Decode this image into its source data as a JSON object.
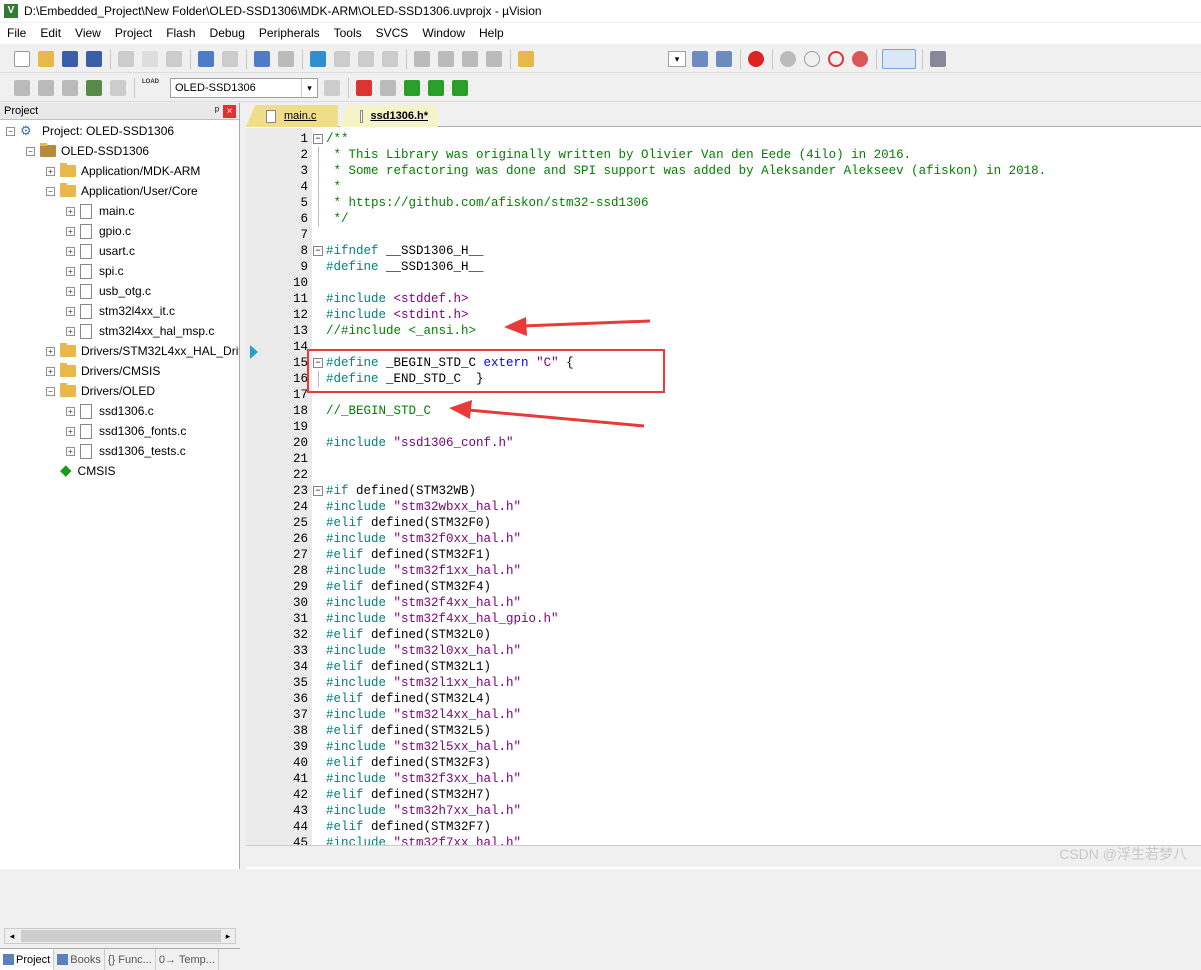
{
  "window": {
    "title": "D:\\Embedded_Project\\New Folder\\OLED-SSD1306\\MDK-ARM\\OLED-SSD1306.uvprojx - µVision",
    "app_icon": "V"
  },
  "menu": [
    "File",
    "Edit",
    "View",
    "Project",
    "Flash",
    "Debug",
    "Peripherals",
    "Tools",
    "SVCS",
    "Window",
    "Help"
  ],
  "toolbar2": {
    "target": "OLED-SSD1306",
    "load_label": "LOAD"
  },
  "project_panel": {
    "title": "Project",
    "pin": "ᵖ",
    "close": "×",
    "tree": [
      {
        "label": "Project: OLED-SSD1306",
        "kind": "project",
        "exp": "−"
      },
      {
        "label": "OLED-SSD1306",
        "kind": "target",
        "exp": "−"
      },
      {
        "label": "Application/MDK-ARM",
        "kind": "folder",
        "exp": "+"
      },
      {
        "label": "Application/User/Core",
        "kind": "folder",
        "exp": "−"
      },
      {
        "label": "main.c",
        "kind": "file",
        "exp": "+"
      },
      {
        "label": "gpio.c",
        "kind": "file",
        "exp": "+"
      },
      {
        "label": "usart.c",
        "kind": "file",
        "exp": "+"
      },
      {
        "label": "spi.c",
        "kind": "file",
        "exp": "+"
      },
      {
        "label": "usb_otg.c",
        "kind": "file",
        "exp": "+"
      },
      {
        "label": "stm32l4xx_it.c",
        "kind": "file",
        "exp": "+"
      },
      {
        "label": "stm32l4xx_hal_msp.c",
        "kind": "file",
        "exp": "+"
      },
      {
        "label": "Drivers/STM32L4xx_HAL_Driv",
        "kind": "folder",
        "exp": "+"
      },
      {
        "label": "Drivers/CMSIS",
        "kind": "folder",
        "exp": "+"
      },
      {
        "label": "Drivers/OLED",
        "kind": "folder",
        "exp": "−"
      },
      {
        "label": "ssd1306.c",
        "kind": "file",
        "exp": "+"
      },
      {
        "label": "ssd1306_fonts.c",
        "kind": "file",
        "exp": "+"
      },
      {
        "label": "ssd1306_tests.c",
        "kind": "file",
        "exp": "+"
      },
      {
        "label": "CMSIS",
        "kind": "cmsis",
        "exp": ""
      }
    ],
    "tabs": [
      "Project",
      "Books",
      "{} Func...",
      "0→ Temp..."
    ]
  },
  "editor": {
    "tabs": [
      {
        "label": "main.c",
        "active": false
      },
      {
        "label": "ssd1306.h*",
        "active": true
      }
    ],
    "lines": [
      {
        "n": "1",
        "fold": "−",
        "segs": [
          {
            "c": "cm",
            "t": "/**"
          }
        ]
      },
      {
        "n": "2",
        "fold": "|",
        "segs": [
          {
            "c": "cm",
            "t": " * This Library was originally written by Olivier Van den Eede (4ilo) in 2016."
          }
        ]
      },
      {
        "n": "3",
        "fold": "|",
        "segs": [
          {
            "c": "cm",
            "t": " * Some refactoring was done and SPI support was added by Aleksander Alekseev (afiskon) in 2018."
          }
        ]
      },
      {
        "n": "4",
        "fold": "|",
        "segs": [
          {
            "c": "cm",
            "t": " *"
          }
        ]
      },
      {
        "n": "5",
        "fold": "|",
        "segs": [
          {
            "c": "cm",
            "t": " * https://github.com/afiskon/stm32-ssd1306"
          }
        ]
      },
      {
        "n": "6",
        "fold": "|",
        "segs": [
          {
            "c": "cm",
            "t": " */"
          }
        ]
      },
      {
        "n": "7",
        "fold": "",
        "segs": []
      },
      {
        "n": "8",
        "fold": "−",
        "segs": [
          {
            "c": "pp",
            "t": "#ifndef"
          },
          {
            "c": "plain",
            "t": " __SSD1306_H__"
          }
        ]
      },
      {
        "n": "9",
        "fold": "",
        "segs": [
          {
            "c": "pp",
            "t": "#define"
          },
          {
            "c": "plain",
            "t": " __SSD1306_H__"
          }
        ]
      },
      {
        "n": "10",
        "fold": "",
        "segs": []
      },
      {
        "n": "11",
        "fold": "",
        "segs": [
          {
            "c": "pp",
            "t": "#include"
          },
          {
            "c": "str",
            "t": " <stddef.h>"
          }
        ]
      },
      {
        "n": "12",
        "fold": "",
        "segs": [
          {
            "c": "pp",
            "t": "#include"
          },
          {
            "c": "str",
            "t": " <stdint.h>"
          }
        ]
      },
      {
        "n": "13",
        "fold": "",
        "segs": [
          {
            "c": "cm",
            "t": "//#include <_ansi.h>"
          }
        ]
      },
      {
        "n": "14",
        "fold": "",
        "segs": []
      },
      {
        "n": "15",
        "fold": "−",
        "segs": [
          {
            "c": "pp",
            "t": "#define"
          },
          {
            "c": "plain",
            "t": " _BEGIN_STD_C "
          },
          {
            "c": "kw",
            "t": "extern"
          },
          {
            "c": "str",
            "t": " \"C\""
          },
          {
            "c": "plain",
            "t": " {"
          }
        ]
      },
      {
        "n": "16",
        "fold": "|",
        "segs": [
          {
            "c": "pp",
            "t": "#define"
          },
          {
            "c": "plain",
            "t": " _END_STD_C  }"
          }
        ]
      },
      {
        "n": "17",
        "fold": "",
        "segs": []
      },
      {
        "n": "18",
        "fold": "",
        "segs": [
          {
            "c": "cm",
            "t": "//_BEGIN_STD_C"
          }
        ]
      },
      {
        "n": "19",
        "fold": "",
        "segs": []
      },
      {
        "n": "20",
        "fold": "",
        "segs": [
          {
            "c": "pp",
            "t": "#include"
          },
          {
            "c": "str",
            "t": " \"ssd1306_conf.h\""
          }
        ]
      },
      {
        "n": "21",
        "fold": "",
        "segs": []
      },
      {
        "n": "22",
        "fold": "",
        "segs": []
      },
      {
        "n": "23",
        "fold": "−",
        "segs": [
          {
            "c": "pp",
            "t": "#if"
          },
          {
            "c": "plain",
            "t": " defined(STM32WB)"
          }
        ]
      },
      {
        "n": "24",
        "fold": "",
        "segs": [
          {
            "c": "pp",
            "t": "#include"
          },
          {
            "c": "str",
            "t": " \"stm32wbxx_hal.h\""
          }
        ]
      },
      {
        "n": "25",
        "fold": "",
        "segs": [
          {
            "c": "pp",
            "t": "#elif"
          },
          {
            "c": "plain",
            "t": " defined(STM32F0)"
          }
        ]
      },
      {
        "n": "26",
        "fold": "",
        "segs": [
          {
            "c": "pp",
            "t": "#include"
          },
          {
            "c": "str",
            "t": " \"stm32f0xx_hal.h\""
          }
        ]
      },
      {
        "n": "27",
        "fold": "",
        "segs": [
          {
            "c": "pp",
            "t": "#elif"
          },
          {
            "c": "plain",
            "t": " defined(STM32F1)"
          }
        ]
      },
      {
        "n": "28",
        "fold": "",
        "segs": [
          {
            "c": "pp",
            "t": "#include"
          },
          {
            "c": "str",
            "t": " \"stm32f1xx_hal.h\""
          }
        ]
      },
      {
        "n": "29",
        "fold": "",
        "segs": [
          {
            "c": "pp",
            "t": "#elif"
          },
          {
            "c": "plain",
            "t": " defined(STM32F4)"
          }
        ]
      },
      {
        "n": "30",
        "fold": "",
        "segs": [
          {
            "c": "pp",
            "t": "#include"
          },
          {
            "c": "str",
            "t": " \"stm32f4xx_hal.h\""
          }
        ]
      },
      {
        "n": "31",
        "fold": "",
        "segs": [
          {
            "c": "pp",
            "t": "#include"
          },
          {
            "c": "str",
            "t": " \"stm32f4xx_hal_gpio.h\""
          }
        ]
      },
      {
        "n": "32",
        "fold": "",
        "segs": [
          {
            "c": "pp",
            "t": "#elif"
          },
          {
            "c": "plain",
            "t": " defined(STM32L0)"
          }
        ]
      },
      {
        "n": "33",
        "fold": "",
        "segs": [
          {
            "c": "pp",
            "t": "#include"
          },
          {
            "c": "str",
            "t": " \"stm32l0xx_hal.h\""
          }
        ]
      },
      {
        "n": "34",
        "fold": "",
        "segs": [
          {
            "c": "pp",
            "t": "#elif"
          },
          {
            "c": "plain",
            "t": " defined(STM32L1)"
          }
        ]
      },
      {
        "n": "35",
        "fold": "",
        "segs": [
          {
            "c": "pp",
            "t": "#include"
          },
          {
            "c": "str",
            "t": " \"stm32l1xx_hal.h\""
          }
        ]
      },
      {
        "n": "36",
        "fold": "",
        "segs": [
          {
            "c": "pp",
            "t": "#elif"
          },
          {
            "c": "plain",
            "t": " defined(STM32L4)"
          }
        ]
      },
      {
        "n": "37",
        "fold": "",
        "segs": [
          {
            "c": "pp",
            "t": "#include"
          },
          {
            "c": "str",
            "t": " \"stm32l4xx_hal.h\""
          }
        ]
      },
      {
        "n": "38",
        "fold": "",
        "segs": [
          {
            "c": "pp",
            "t": "#elif"
          },
          {
            "c": "plain",
            "t": " defined(STM32L5)"
          }
        ]
      },
      {
        "n": "39",
        "fold": "",
        "segs": [
          {
            "c": "pp",
            "t": "#include"
          },
          {
            "c": "str",
            "t": " \"stm32l5xx_hal.h\""
          }
        ]
      },
      {
        "n": "40",
        "fold": "",
        "segs": [
          {
            "c": "pp",
            "t": "#elif"
          },
          {
            "c": "plain",
            "t": " defined(STM32F3)"
          }
        ]
      },
      {
        "n": "41",
        "fold": "",
        "segs": [
          {
            "c": "pp",
            "t": "#include"
          },
          {
            "c": "str",
            "t": " \"stm32f3xx_hal.h\""
          }
        ]
      },
      {
        "n": "42",
        "fold": "",
        "segs": [
          {
            "c": "pp",
            "t": "#elif"
          },
          {
            "c": "plain",
            "t": " defined(STM32H7)"
          }
        ]
      },
      {
        "n": "43",
        "fold": "",
        "segs": [
          {
            "c": "pp",
            "t": "#include"
          },
          {
            "c": "str",
            "t": " \"stm32h7xx_hal.h\""
          }
        ]
      },
      {
        "n": "44",
        "fold": "",
        "segs": [
          {
            "c": "pp",
            "t": "#elif"
          },
          {
            "c": "plain",
            "t": " defined(STM32F7)"
          }
        ]
      },
      {
        "n": "45",
        "fold": "",
        "segs": [
          {
            "c": "pp",
            "t": "#include"
          },
          {
            "c": "str",
            "t": " \"stm32f7xx_hal.h\""
          }
        ]
      }
    ]
  },
  "watermark": "CSDN @浮生若梦八",
  "colors": {
    "annotation_red": "#e83a3a",
    "comment": "#008000",
    "preprocessor": "#008080",
    "string": "#800080",
    "keyword": "#0000ff"
  }
}
